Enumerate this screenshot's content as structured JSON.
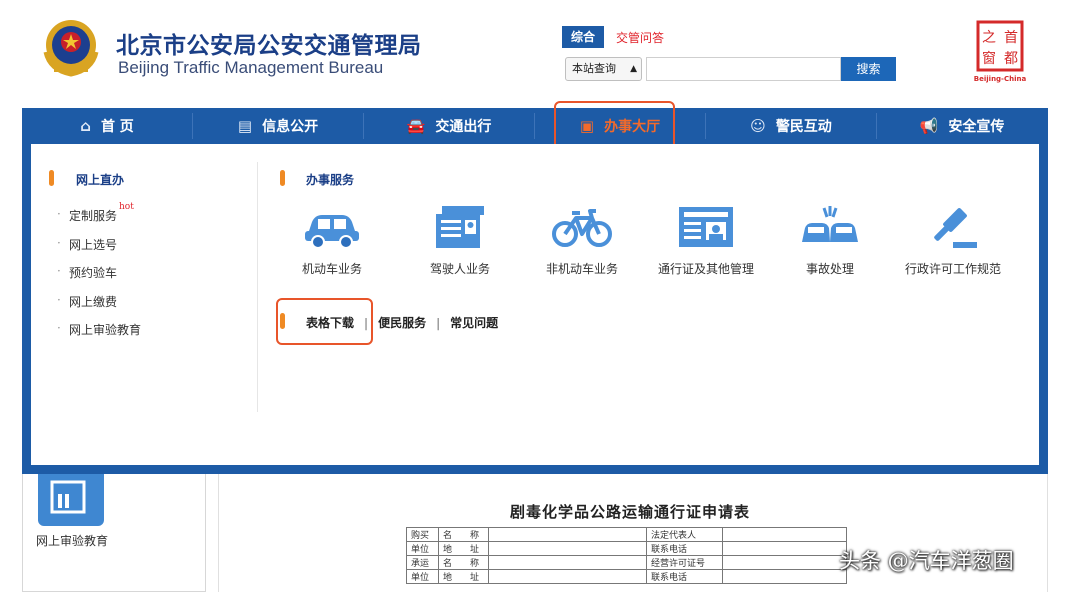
{
  "header": {
    "title_cn": "北京市公安局公安交通管理局",
    "title_en": "Beijing Traffic Management Bureau",
    "emblem_icon": "police-emblem-icon",
    "seal_text": [
      "首",
      "都",
      "之",
      "窗"
    ],
    "seal_caption": "Beijing-China"
  },
  "search": {
    "tab_active": "综合",
    "tab_other": "交管问答",
    "scope_value": "本站查询",
    "query": "",
    "button": "搜索"
  },
  "nav": {
    "items": [
      {
        "label": "首 页",
        "icon": "home-icon"
      },
      {
        "label": "信息公开",
        "icon": "document-icon"
      },
      {
        "label": "交通出行",
        "icon": "car-icon"
      },
      {
        "label": "办事大厅",
        "icon": "briefcase-icon",
        "active": true
      },
      {
        "label": "警民互动",
        "icon": "people-icon"
      },
      {
        "label": "安全宣传",
        "icon": "megaphone-icon"
      }
    ],
    "active_color": "#f26a2a",
    "bar_color": "#1d5ba6"
  },
  "panel": {
    "left_title": "网上直办",
    "left_items": [
      "定制服务",
      "网上选号",
      "预约验车",
      "网上缴费",
      "网上审验教育"
    ],
    "hot_badge": "hot",
    "right_title": "办事服务",
    "services": [
      {
        "label": "机动车业务",
        "icon": "car-icon"
      },
      {
        "label": "驾驶人业务",
        "icon": "license-icon"
      },
      {
        "label": "非机动车业务",
        "icon": "bicycle-icon"
      },
      {
        "label": "通行证及其他管理",
        "icon": "permit-card-icon"
      },
      {
        "label": "事故处理",
        "icon": "accident-icon"
      },
      {
        "label": "行政许可工作规范",
        "icon": "gavel-icon"
      }
    ],
    "links": [
      "表格下载",
      "便民服务",
      "常见问题"
    ],
    "link_separator": "|"
  },
  "lower": {
    "tile_label": "网上审验教育",
    "form_title": "剧毒化学品公路运输通行证申请表",
    "form_rows": [
      [
        "购买",
        "名　　称",
        "",
        "法定代表人",
        ""
      ],
      [
        "单位",
        "地　　址",
        "",
        "联系电话",
        ""
      ],
      [
        "承运",
        "名　　称",
        "",
        "经营许可证号",
        ""
      ],
      [
        "单位",
        "地　　址",
        "",
        "联系电话",
        ""
      ]
    ]
  },
  "watermark": "头条 @汽车洋葱圈",
  "highlight_color": "#e8552a"
}
